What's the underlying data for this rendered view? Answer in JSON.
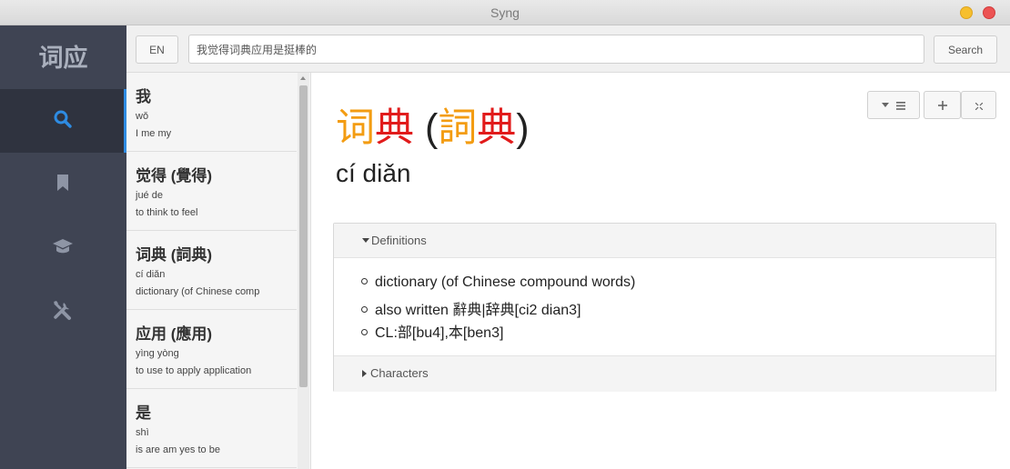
{
  "window": {
    "title": "Syng"
  },
  "nav": {
    "brand": "词应",
    "items": [
      {
        "name": "search",
        "icon": "search-icon"
      },
      {
        "name": "bookmarks",
        "icon": "bookmark-icon"
      },
      {
        "name": "learn",
        "icon": "graduation-cap-icon"
      },
      {
        "name": "tools",
        "icon": "tools-icon"
      }
    ],
    "accent_color": "#2e8ce3"
  },
  "topbar": {
    "lang_label": "EN",
    "search_value": "我觉得词典应用是挺棒的",
    "search_label": "Search"
  },
  "results": [
    {
      "word": "我",
      "pinyin": "wǒ",
      "gloss": "I me my"
    },
    {
      "word": "觉得 (覺得)",
      "pinyin": "jué de",
      "gloss": "to think to feel"
    },
    {
      "word": "词典 (詞典)",
      "pinyin": "cí diǎn",
      "gloss": "dictionary (of Chinese comp"
    },
    {
      "word": "应用 (應用)",
      "pinyin": "yìng yòng",
      "gloss": "to use to apply application"
    },
    {
      "word": "是",
      "pinyin": "shì",
      "gloss": "is are am yes to be"
    }
  ],
  "detail": {
    "simplified": [
      "词",
      "典"
    ],
    "traditional": [
      "詞",
      "典"
    ],
    "pinyin": "cí diǎn",
    "tone_colors": {
      "tone2": "#f39c12",
      "tone3": "#e11b1b"
    },
    "definitions_label": "Definitions",
    "definitions": [
      "dictionary (of Chinese compound words)",
      "also written 辭典|辞典[ci2 dian3]",
      "CL:部[bu4],本[ben3]"
    ],
    "characters_label": "Characters"
  }
}
